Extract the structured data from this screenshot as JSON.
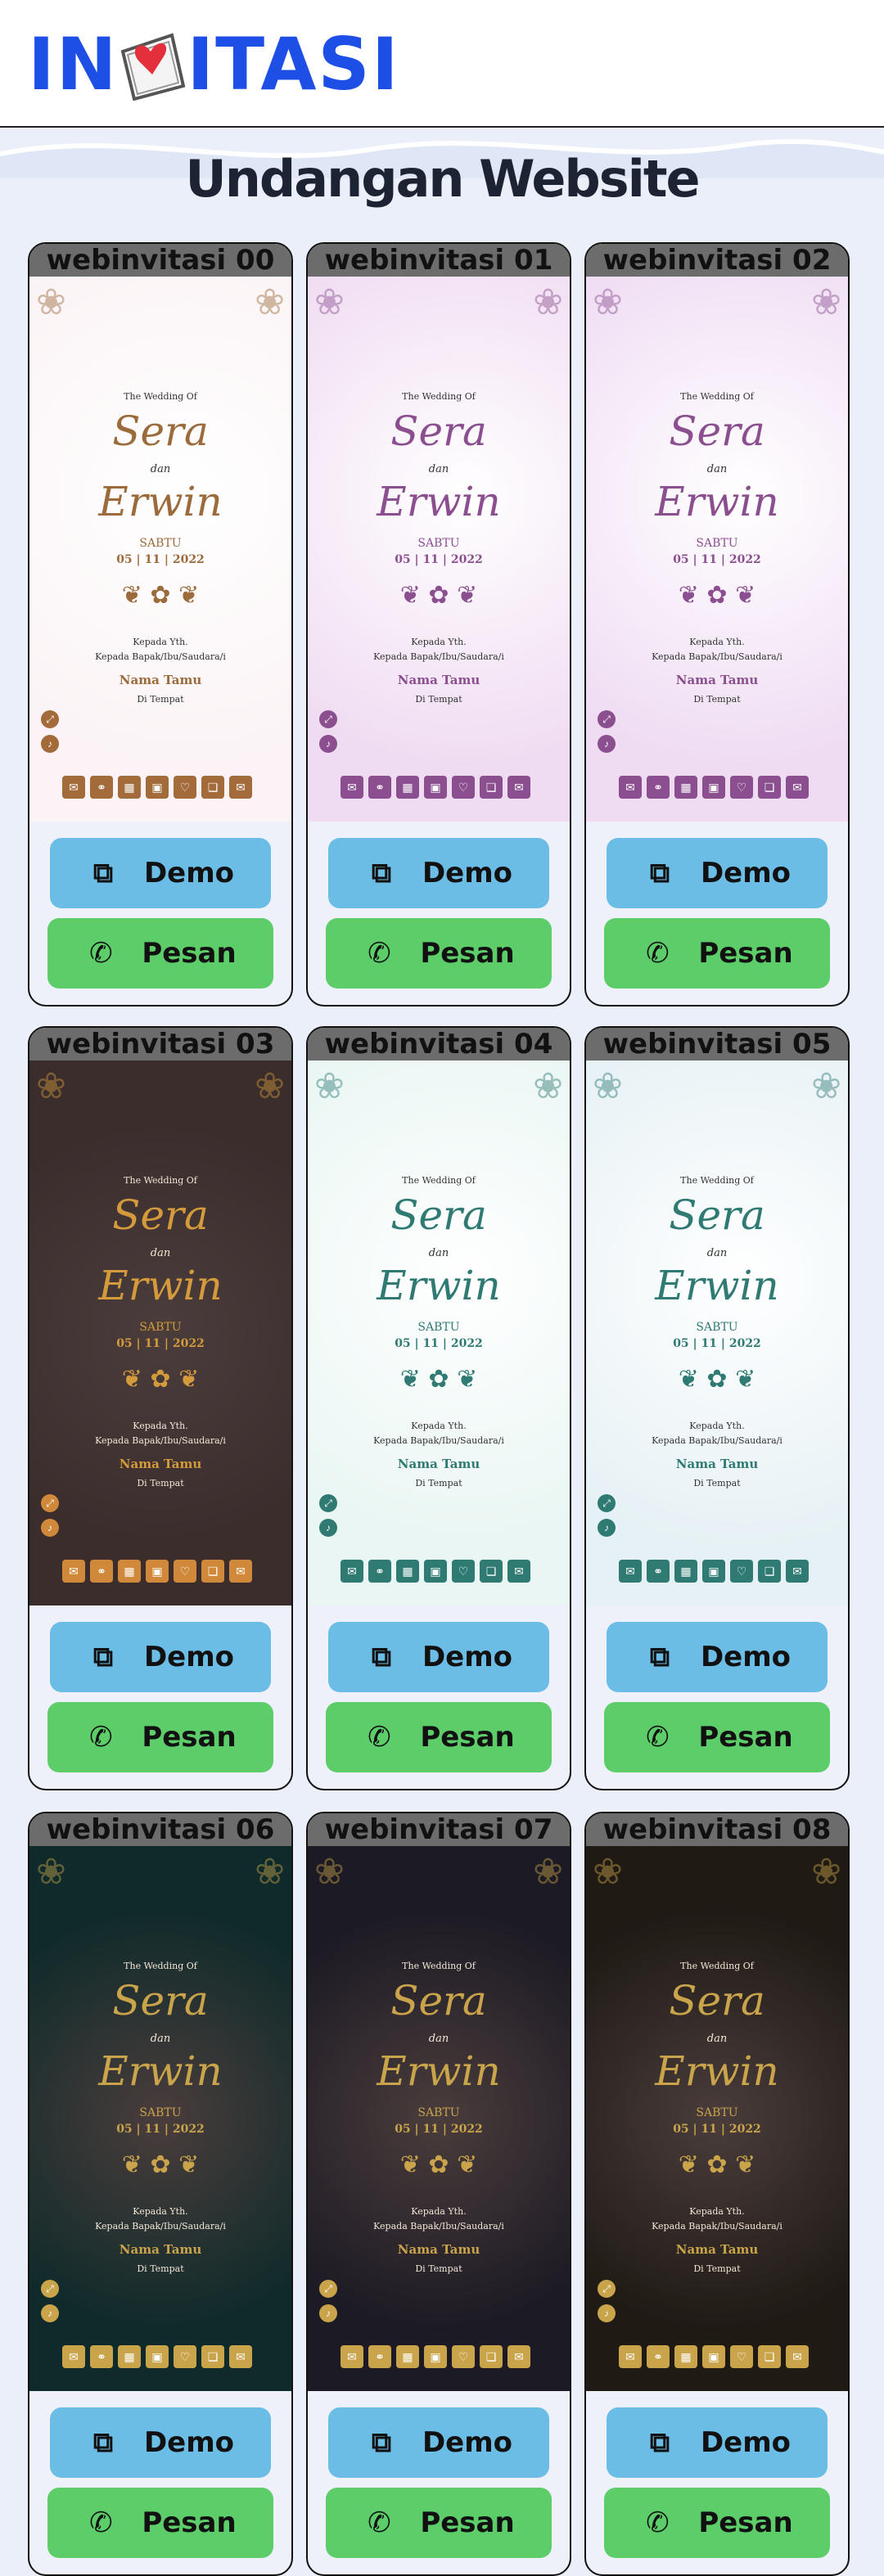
{
  "logo": {
    "left": "IN",
    "right": "ITASI"
  },
  "title": "Undangan Website",
  "preview_text": {
    "heading": "The Wedding Of",
    "bride": "Sera",
    "dan": "dan",
    "groom": "Erwin",
    "day": "SABTU",
    "date": "05 | 11 | 2022",
    "kepada": "Kepada Yth.",
    "kepada2": "Kepada Bapak/Ibu/Saudara/i",
    "guest": "Nama Tamu",
    "place": "Di Tempat"
  },
  "buttons": {
    "demo": "Demo",
    "order": "Pesan"
  },
  "cards": [
    {
      "name": "webinvitasi 00",
      "bg": "#fbf3f5",
      "accent": "#9c6b3b",
      "iconbar": "#a36a3a"
    },
    {
      "name": "webinvitasi 01",
      "bg": "#f0dcf2",
      "accent": "#8b4f90",
      "iconbar": "#8b4f90"
    },
    {
      "name": "webinvitasi 02",
      "bg": "#efdcf3",
      "accent": "#8b4f90",
      "iconbar": "#8b4f90"
    },
    {
      "name": "webinvitasi 03",
      "bg": "#3a2d2c",
      "accent": "#d49a3c",
      "iconbar": "#d0893a"
    },
    {
      "name": "webinvitasi 04",
      "bg": "#e9f6f3",
      "accent": "#2f7a73",
      "iconbar": "#2f7a73"
    },
    {
      "name": "webinvitasi 05",
      "bg": "#e6f1f5",
      "accent": "#2f7a73",
      "iconbar": "#2f7a73"
    },
    {
      "name": "webinvitasi 06",
      "bg": "#0f2a2a",
      "accent": "#c9a44b",
      "iconbar": "#c9a44b"
    },
    {
      "name": "webinvitasi 07",
      "bg": "#1c1a24",
      "accent": "#c9a44b",
      "iconbar": "#c9a44b"
    },
    {
      "name": "webinvitasi 08",
      "bg": "#1f1a14",
      "accent": "#c9a44b",
      "iconbar": "#c9a44b"
    }
  ]
}
